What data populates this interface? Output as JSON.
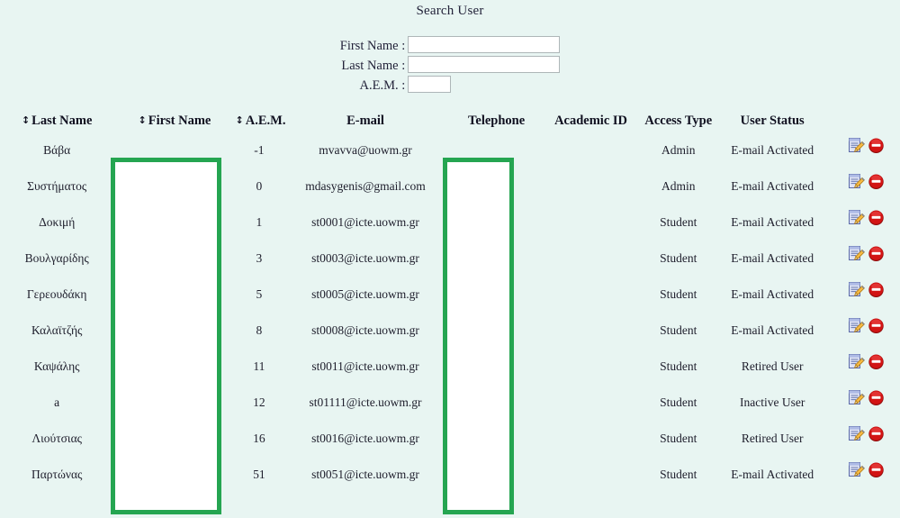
{
  "search": {
    "title": "Search User",
    "fields": [
      {
        "label": "First Name :",
        "value": "",
        "name": "first-name-field"
      },
      {
        "label": "Last Name :",
        "value": "",
        "name": "last-name-field"
      },
      {
        "label": "A.E.M. :",
        "value": "",
        "name": "aem-field"
      }
    ]
  },
  "table": {
    "sort_icon": "↕",
    "columns": [
      {
        "label": "Last Name",
        "sortable": true
      },
      {
        "label": "First Name",
        "sortable": true
      },
      {
        "label": "A.E.M.",
        "sortable": true
      },
      {
        "label": "E-mail",
        "sortable": false
      },
      {
        "label": "Telephone",
        "sortable": false
      },
      {
        "label": "Academic ID",
        "sortable": false
      },
      {
        "label": "Access Type",
        "sortable": false
      },
      {
        "label": "User Status",
        "sortable": false
      },
      {
        "label": "",
        "sortable": false
      }
    ],
    "rows": [
      {
        "last_name": "Βάβα",
        "first_name": "",
        "aem": "-1",
        "email": "mvavva@uowm.gr",
        "telephone": "",
        "academic_id": "",
        "access_type": "Admin",
        "user_status": "E-mail Activated"
      },
      {
        "last_name": "Συστήματος",
        "first_name": "",
        "aem": "0",
        "email": "mdasygenis@gmail.com",
        "telephone": "",
        "academic_id": "",
        "access_type": "Admin",
        "user_status": "E-mail Activated"
      },
      {
        "last_name": "Δοκιμή",
        "first_name": "",
        "aem": "1",
        "email": "st0001@icte.uowm.gr",
        "telephone": "",
        "academic_id": "",
        "access_type": "Student",
        "user_status": "E-mail Activated"
      },
      {
        "last_name": "Βουλγαρίδης",
        "first_name": "",
        "aem": "3",
        "email": "st0003@icte.uowm.gr",
        "telephone": "",
        "academic_id": "",
        "access_type": "Student",
        "user_status": "E-mail Activated"
      },
      {
        "last_name": "Γερεουδάκη",
        "first_name": "",
        "aem": "5",
        "email": "st0005@icte.uowm.gr",
        "telephone": "",
        "academic_id": "",
        "access_type": "Student",
        "user_status": "E-mail Activated"
      },
      {
        "last_name": "Καλαϊτζής",
        "first_name": "",
        "aem": "8",
        "email": "st0008@icte.uowm.gr",
        "telephone": "",
        "academic_id": "",
        "access_type": "Student",
        "user_status": "E-mail Activated"
      },
      {
        "last_name": "Καψάλης",
        "first_name": "",
        "aem": "11",
        "email": "st0011@icte.uowm.gr",
        "telephone": "",
        "academic_id": "",
        "access_type": "Student",
        "user_status": "Retired User"
      },
      {
        "last_name": "a",
        "first_name": "",
        "aem": "12",
        "email": "st01111@icte.uowm.gr",
        "telephone": "",
        "academic_id": "",
        "access_type": "Student",
        "user_status": "Inactive User"
      },
      {
        "last_name": "Λιούτσιας",
        "first_name": "",
        "aem": "16",
        "email": "st0016@icte.uowm.gr",
        "telephone": "",
        "academic_id": "",
        "access_type": "Student",
        "user_status": "Retired User"
      },
      {
        "last_name": "Παρτώνας",
        "first_name": "",
        "aem": "51",
        "email": "st0051@icte.uowm.gr",
        "telephone": "",
        "academic_id": "",
        "access_type": "Student",
        "user_status": "E-mail Activated"
      }
    ],
    "row_actions": {
      "edit_icon": "edit-icon",
      "delete_icon": "delete-icon"
    }
  },
  "highlights": [
    {
      "name": "first-name-column-highlight",
      "column": "First Name"
    },
    {
      "name": "telephone-column-highlight",
      "column": "Telephone"
    }
  ],
  "colors": {
    "page_background": "#e8f5f2",
    "highlight_border": "#25a551",
    "highlight_fill": "#ffffff",
    "text": "#20202e",
    "delete_icon": "#cc1111",
    "input_border": "#aeb6b8"
  }
}
